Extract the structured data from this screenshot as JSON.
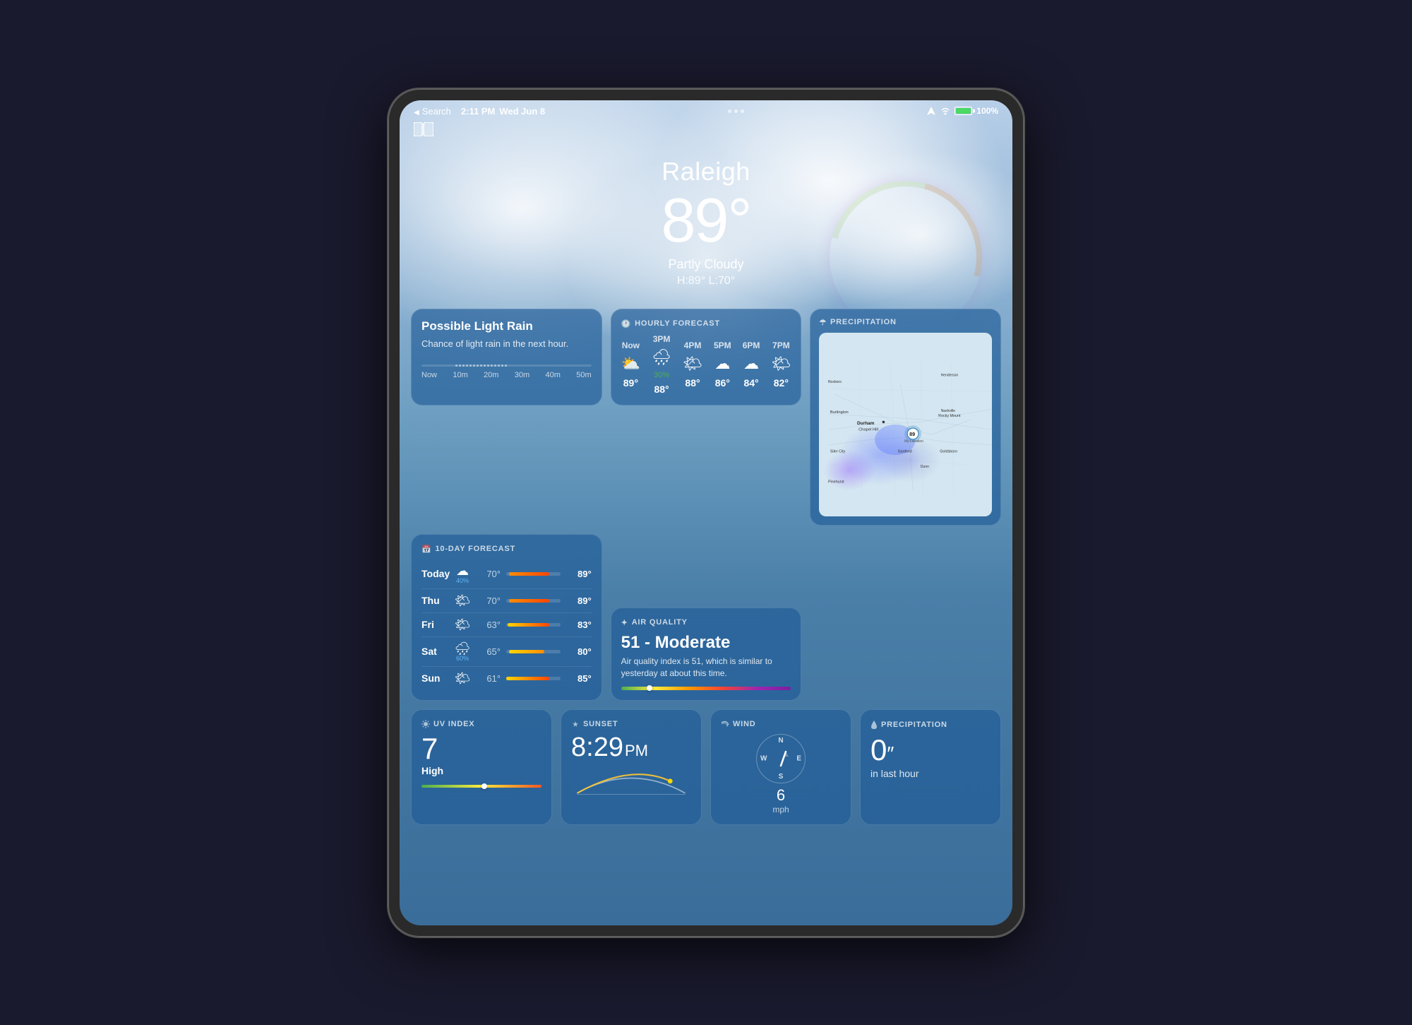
{
  "statusBar": {
    "search": "Search",
    "time": "2:11 PM",
    "date": "Wed Jun 8",
    "battery": "100%",
    "dots": 3
  },
  "weather": {
    "city": "Raleigh",
    "temperature": "89°",
    "condition": "Partly Cloudy",
    "high": "H:89°",
    "low": "L:70°"
  },
  "precipAlert": {
    "title": "Possible Light Rain",
    "description": "Chance of light rain in the next hour.",
    "timeLabels": [
      "Now",
      "10m",
      "20m",
      "30m",
      "40m",
      "50m"
    ]
  },
  "hourlyForecast": {
    "label": "HOURLY FORECAST",
    "hours": [
      {
        "time": "Now",
        "icon": "⛅",
        "temp": "89°",
        "chance": null
      },
      {
        "time": "3PM",
        "icon": "🌧",
        "temp": "88°",
        "chance": "30%"
      },
      {
        "time": "4PM",
        "icon": "🌤",
        "temp": "88°",
        "chance": null
      },
      {
        "time": "5PM",
        "icon": "☁",
        "temp": "86°",
        "chance": null
      },
      {
        "time": "6PM",
        "icon": "☁",
        "temp": "84°",
        "chance": null
      },
      {
        "time": "7PM",
        "icon": "🌤",
        "temp": "82°",
        "chance": null
      }
    ]
  },
  "precipitation": {
    "label": "PRECIPITATION"
  },
  "tenDay": {
    "label": "10-DAY FORECAST",
    "days": [
      {
        "day": "Today",
        "icon": "☁",
        "chance": "40%",
        "low": "70°",
        "high": "89°",
        "barLeft": "10%",
        "barWidth": "75%",
        "gradient": "orange"
      },
      {
        "day": "Thu",
        "icon": "🌤",
        "chance": null,
        "low": "70°",
        "high": "89°",
        "barLeft": "10%",
        "barWidth": "75%",
        "gradient": "orange"
      },
      {
        "day": "Fri",
        "icon": "🌤",
        "chance": null,
        "low": "63°",
        "high": "83°",
        "barLeft": "5%",
        "barWidth": "78%",
        "gradient": "mixed"
      },
      {
        "day": "Sat",
        "icon": "🌧",
        "chance": "60%",
        "low": "65°",
        "high": "80°",
        "barLeft": "8%",
        "barWidth": "68%",
        "gradient": "yellow"
      },
      {
        "day": "Sun",
        "icon": "🌤",
        "chance": null,
        "low": "61°",
        "high": "85°",
        "barLeft": "3%",
        "barWidth": "80%",
        "gradient": "mixed"
      }
    ]
  },
  "airQuality": {
    "label": "AIR QUALITY",
    "value": "51 - Moderate",
    "description": "Air quality index is 51, which is similar to yesterday at about this time.",
    "indicatorPosition": "15%"
  },
  "uvIndex": {
    "label": "UV INDEX",
    "value": "7",
    "level": "High"
  },
  "sunset": {
    "label": "SUNSET",
    "time": "8:29",
    "period": "PM"
  },
  "wind": {
    "label": "WIND",
    "speed": "6",
    "unit": "mph"
  },
  "precipBottom": {
    "label": "PRECIPITATION",
    "value": "0″",
    "sublabel": "in last hour"
  },
  "icons": {
    "clock": "🕐",
    "umbrella": "☂",
    "sparkles": "✦",
    "compass": "🧭",
    "drop": "💧",
    "sun": "☀",
    "wind": "💨",
    "sunset_icon": "🌅"
  }
}
